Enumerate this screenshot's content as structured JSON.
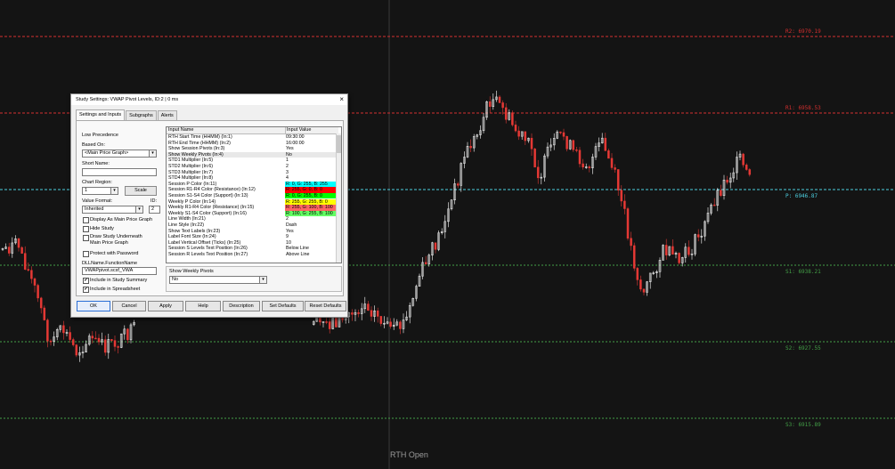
{
  "chart": {
    "background": "#141414",
    "levels": [
      {
        "label": "R2: 6970.19",
        "color": "#d32f2f",
        "kind": "dashed"
      },
      {
        "label": "R1: 6958.53",
        "color": "#d32f2f",
        "kind": "dashed"
      },
      {
        "label": "P: 6946.87",
        "color": "#4dd0e1",
        "kind": "dashed"
      },
      {
        "label": "S1: 6938.21",
        "color": "#43a047",
        "kind": "dotted"
      },
      {
        "label": "S2: 6927.55",
        "color": "#43a047",
        "kind": "dotted"
      },
      {
        "label": "S3: 6915.89",
        "color": "#43a047",
        "kind": "dotted"
      }
    ],
    "session_marker_label": "RTH Open",
    "up_color": "#ffffff",
    "down_color": "#e53935"
  },
  "dialog": {
    "title": "Study Settings: VWAP Pivot Levels, ID:2 | 0 ms",
    "close_glyph": "×",
    "tabs": [
      {
        "label": "Settings and Inputs",
        "active": true
      },
      {
        "label": "Subgraphs",
        "active": false
      },
      {
        "label": "Alerts",
        "active": false
      }
    ],
    "left": {
      "low_precedence": "Low Precedence",
      "based_on_label": "Based On:",
      "based_on_value": "<Main Price Graph>",
      "short_name_label": "Short Name:",
      "short_name_value": "",
      "chart_region_label": "Chart Region:",
      "chart_region_value": "1",
      "scale_button": "Scale",
      "value_format_label": "Value Format:",
      "id_label": "ID:",
      "value_format_value": "Inherited",
      "id_value": "2",
      "checks": [
        {
          "label": "Display As Main Price Graph",
          "checked": false
        },
        {
          "label": "Hide Study",
          "checked": false
        },
        {
          "label": "Draw Study Underneath Main Price Graph",
          "checked": false
        },
        {
          "label": "Protect with Password",
          "checked": false
        }
      ],
      "dll_label": "DLLName.FunctionName",
      "dll_value": "VWAPpivot.scsf_VWA",
      "checks2": [
        {
          "label": "Include in Study Summary",
          "checked": true
        },
        {
          "label": "Include in Spreadsheet",
          "checked": true
        }
      ]
    },
    "inputs_table": {
      "col_name": "Input Name",
      "col_value": "Input Value",
      "rows": [
        {
          "name": "RTH Start Time (HHMM)  (In:1)",
          "value": "09:30:00",
          "bg": ""
        },
        {
          "name": "RTH End Time (HHMM)  (In:2)",
          "value": "16:00:00",
          "bg": ""
        },
        {
          "name": "Show Session Pivots  (In:3)",
          "value": "Yes",
          "bg": ""
        },
        {
          "name": "Show Weekly Pivots  (In:4)",
          "value": "No",
          "bg": "",
          "selected": true
        },
        {
          "name": "STD1 Multiplier  (In:5)",
          "value": "1",
          "bg": ""
        },
        {
          "name": "STD2 Multiplier  (In:6)",
          "value": "2",
          "bg": ""
        },
        {
          "name": "STD3 Multiplier  (In:7)",
          "value": "3",
          "bg": ""
        },
        {
          "name": "STD4 Multiplier  (In:8)",
          "value": "4",
          "bg": ""
        },
        {
          "name": "Session P Color  (In:11)",
          "value": "R: 0, G: 255, B: 255",
          "bg": "#00ffff"
        },
        {
          "name": "Session R1-R4 Color (Resistance)  (In:12)",
          "value": "R: 255, G: 0, B: 0",
          "bg": "#ff0000"
        },
        {
          "name": "Session S1-S4 Color (Support)  (In:13)",
          "value": "R: 0, G: 255, B: 0",
          "bg": "#00ff00"
        },
        {
          "name": "Weekly P Color  (In:14)",
          "value": "R: 255, G: 255, B: 0",
          "bg": "#ffff00"
        },
        {
          "name": "Weekly R1-R4 Color (Resistance)  (In:15)",
          "value": "R: 255, G: 100, B: 100",
          "bg": "#ff6464"
        },
        {
          "name": "Weekly S1-S4 Color (Support)  (In:16)",
          "value": "R: 100, G: 255, B: 100",
          "bg": "#64ff64"
        },
        {
          "name": "Line Width  (In:21)",
          "value": "2",
          "bg": ""
        },
        {
          "name": "Line Style  (In:22)",
          "value": "Dash",
          "bg": ""
        },
        {
          "name": "Show Text Labels  (In:23)",
          "value": "Yes",
          "bg": ""
        },
        {
          "name": "Label Font Size  (In:24)",
          "value": "9",
          "bg": ""
        },
        {
          "name": "Label Vertical Offset (Ticks)  (In:25)",
          "value": "10",
          "bg": ""
        },
        {
          "name": "Session S Levels Text Position  (In:26)",
          "value": "Below Line",
          "bg": ""
        },
        {
          "name": "Session R Levels Text Position  (In:27)",
          "value": "Above Line",
          "bg": ""
        }
      ]
    },
    "selected_input": {
      "label": "Show Weekly Pivots",
      "value": "No"
    },
    "buttons": [
      "OK",
      "Cancel",
      "Apply",
      "Help",
      "Description",
      "Set Defaults",
      "Reset Defaults"
    ]
  }
}
